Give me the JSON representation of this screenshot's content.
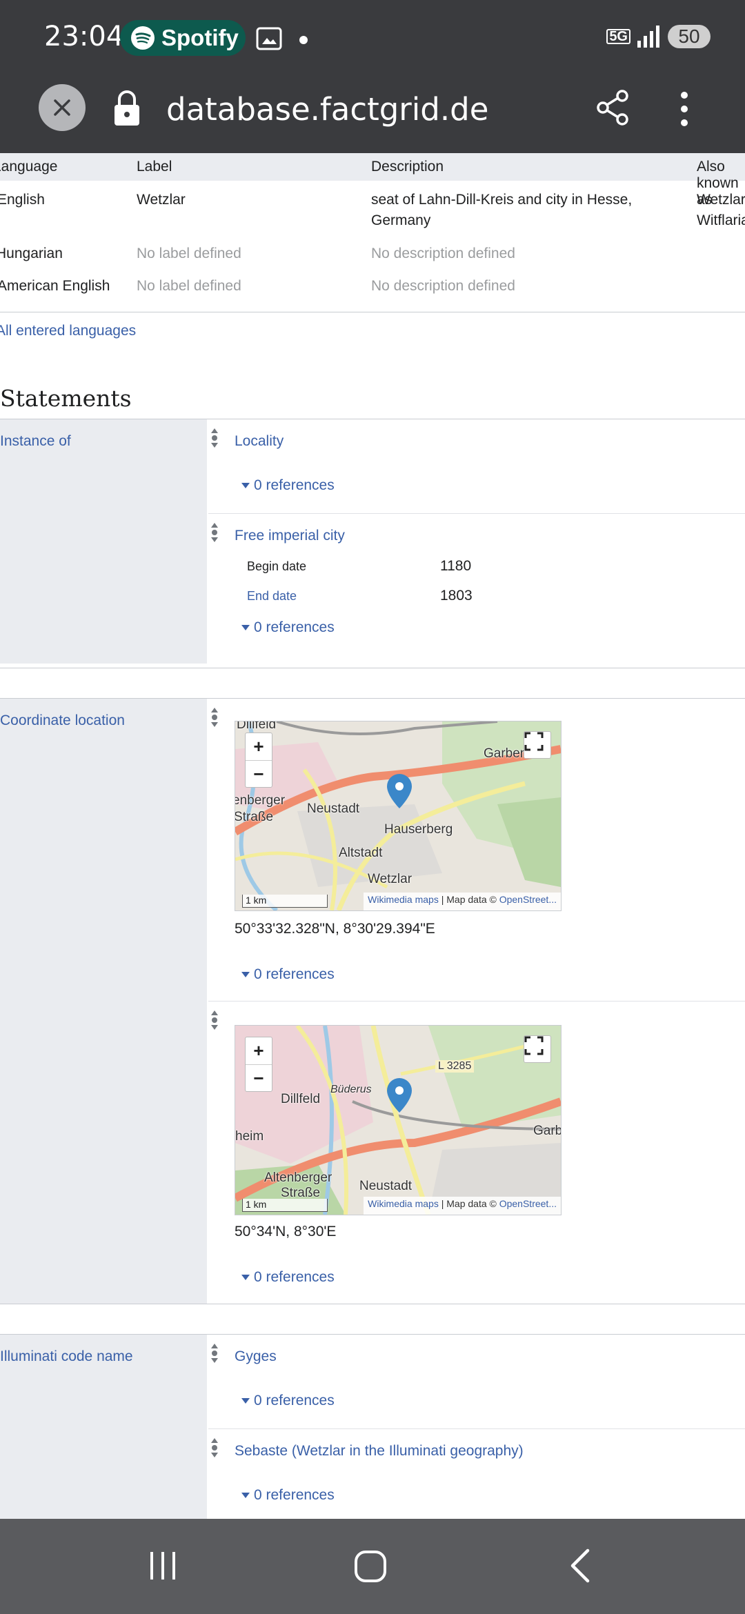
{
  "status": {
    "time": "23:04",
    "app": "Spotify",
    "network": "5G",
    "battery": "50"
  },
  "browser": {
    "url": "database.factgrid.de"
  },
  "languages": {
    "headers": [
      "Language",
      "Label",
      "Description",
      "Also known as"
    ],
    "rows": [
      {
        "language": "English",
        "label": "Wetzlar",
        "description1": "seat of Lahn-Dill-Kreis and city in Hesse,",
        "description2": "Germany",
        "aka1": "Wetzlar",
        "aka2": "Witflaria"
      },
      {
        "language": "Hungarian",
        "label": "No label defined",
        "description1": "No description defined"
      },
      {
        "language": "American English",
        "label": "No label defined",
        "description1": "No description defined"
      }
    ],
    "all_link": "All entered languages"
  },
  "statements_title": "Statements",
  "references_label": "0 references",
  "statements": {
    "instance_of": {
      "label": "Instance of",
      "value1": "Locality",
      "value2": "Free imperial city",
      "begin_label": "Begin date",
      "begin_value": "1180",
      "end_label": "End date",
      "end_value": "1803"
    },
    "coordinate": {
      "label": "Coordinate location",
      "map1": {
        "labels": [
          "Dillfeld",
          "Garben",
          "enberger",
          "Straße",
          "Neustadt",
          "Hauserberg",
          "Altstadt",
          "Wetzlar"
        ],
        "coord": "50°33'32.328\"N, 8°30'29.394\"E"
      },
      "map2": {
        "labels": [
          "Büderus",
          "Dillfeld",
          "L 3285",
          "heim",
          "Garb",
          "Altenberger",
          "Straße",
          "Neustadt"
        ],
        "coord": "50°34'N, 8°30'E"
      },
      "scale": "1 km",
      "attrib_link": "Wikimedia maps",
      "attrib_text": " | Map data © ",
      "attrib_osm": "OpenStreet..."
    },
    "illuminati": {
      "label": "Illuminati code name",
      "value1": "Gyges",
      "value2": "Sebaste (Wetzlar in the Illuminati geography)"
    }
  },
  "colors": {
    "link": "#3a60a8",
    "prop_bg": "#eaecf0",
    "bar": "#3a3b3e",
    "spotify": "#0d5a4e"
  }
}
